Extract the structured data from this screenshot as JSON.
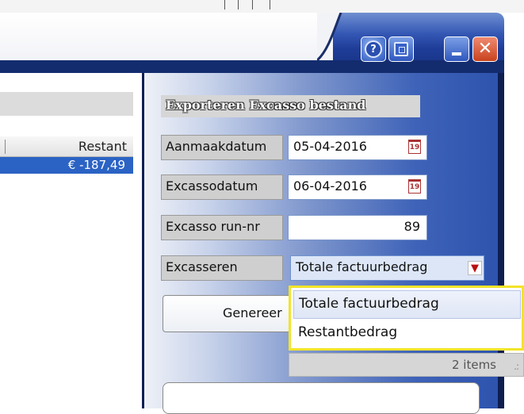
{
  "window": {
    "help_icon": "help-icon",
    "screenshot_icon": "screenshot-icon",
    "minimize_icon": "minimize-icon",
    "close_icon": "close-icon",
    "colors": {
      "titlebar": "#1e3d98",
      "close": "#d9532b",
      "highlight": "#f2e428"
    }
  },
  "grid": {
    "column_header": "Restant",
    "row_value": "€ -187,49"
  },
  "export_panel": {
    "title": "Exporteren Excasso bestand",
    "aanmaakdatum_label": "Aanmaakdatum",
    "aanmaakdatum_value": "05-04-2016",
    "excassodatum_label": "Excassodatum",
    "excassodatum_value": "06-04-2016",
    "calendar_glyph": "19",
    "runnr_label": "Excasso run-nr",
    "runnr_value": "89",
    "excasseren_label": "Excasseren",
    "excasseren_selected": "Totale factuurbedrag",
    "generate_button": "Genereer"
  },
  "dropdown": {
    "options": [
      "Totale factuurbedrag",
      "Restantbedrag"
    ],
    "footer": "2 items"
  }
}
